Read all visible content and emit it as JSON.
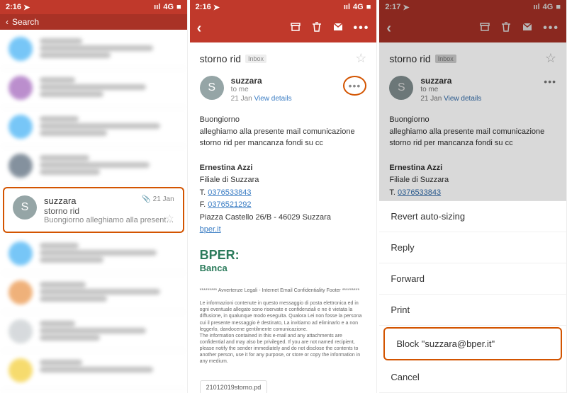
{
  "status": {
    "time1": "2:16",
    "time2": "2:16",
    "time3": "2:17",
    "signal": "ııl",
    "network": "4G",
    "battery": "■"
  },
  "search_label": "Search",
  "list": {
    "highlighted": {
      "avatar_letter": "S",
      "sender": "suzzara",
      "subject": "storno rid",
      "preview": "Buongiorno alleghiamo alla presente mail c...",
      "date": "21 Jan",
      "attach_icon": "📎"
    }
  },
  "toolbar_icons": {
    "back": "‹",
    "archive": "▢",
    "trash": "🗑",
    "mail": "✉",
    "more": "•••"
  },
  "detail": {
    "subject": "storno rid",
    "badge": "Inbox",
    "sender": "suzzara",
    "avatar_letter": "S",
    "to": "to me",
    "date": "21 Jan",
    "view_details": "View details",
    "body_line1": "Buongiorno",
    "body_line2": "alleghiamo alla presente mail comunicazione storno rid per mancanza fondi su cc",
    "sig": {
      "name": "Ernestina Azzi",
      "branch": "Filiale di Suzzara",
      "tel_label": "T.",
      "tel": "0376533843",
      "fax_label": "F.",
      "fax": "0376521292",
      "addr": "Piazza Castello 26/B - 46029 Suzzara",
      "web": "bper.it"
    },
    "bper_top": "BPER:",
    "bper_bottom": "Banca",
    "footer_title": "********* Avvertenze Legali - Internet Email Confidentiality Footer *********",
    "footer_it": "Le informazioni contenute in questo messaggio di posta elettronica ed in ogni eventuale allegato sono riservate e confidenziali e ne è vietata la diffusione, in qualunque modo eseguita. Qualora Lei non fosse la persona cui il presente messaggio è destinato, La invitiamo ad eliminarlo e a non leggerlo, dandocene gentilmente comunicazione.",
    "footer_en": "The information contained in this e-mail and any attachments are confidential and may also be privileged. If you are not named recipient, please notify the sender immediately and do not disclose the contents to another person, use it for any purpose, or store or copy the information in any medium.",
    "attachment": "21012019storno.pd"
  },
  "action_sheet": {
    "revert": "Revert auto-sizing",
    "reply": "Reply",
    "forward": "Forward",
    "print": "Print",
    "block": "Block \"suzzara@bper.it\"",
    "cancel": "Cancel"
  }
}
